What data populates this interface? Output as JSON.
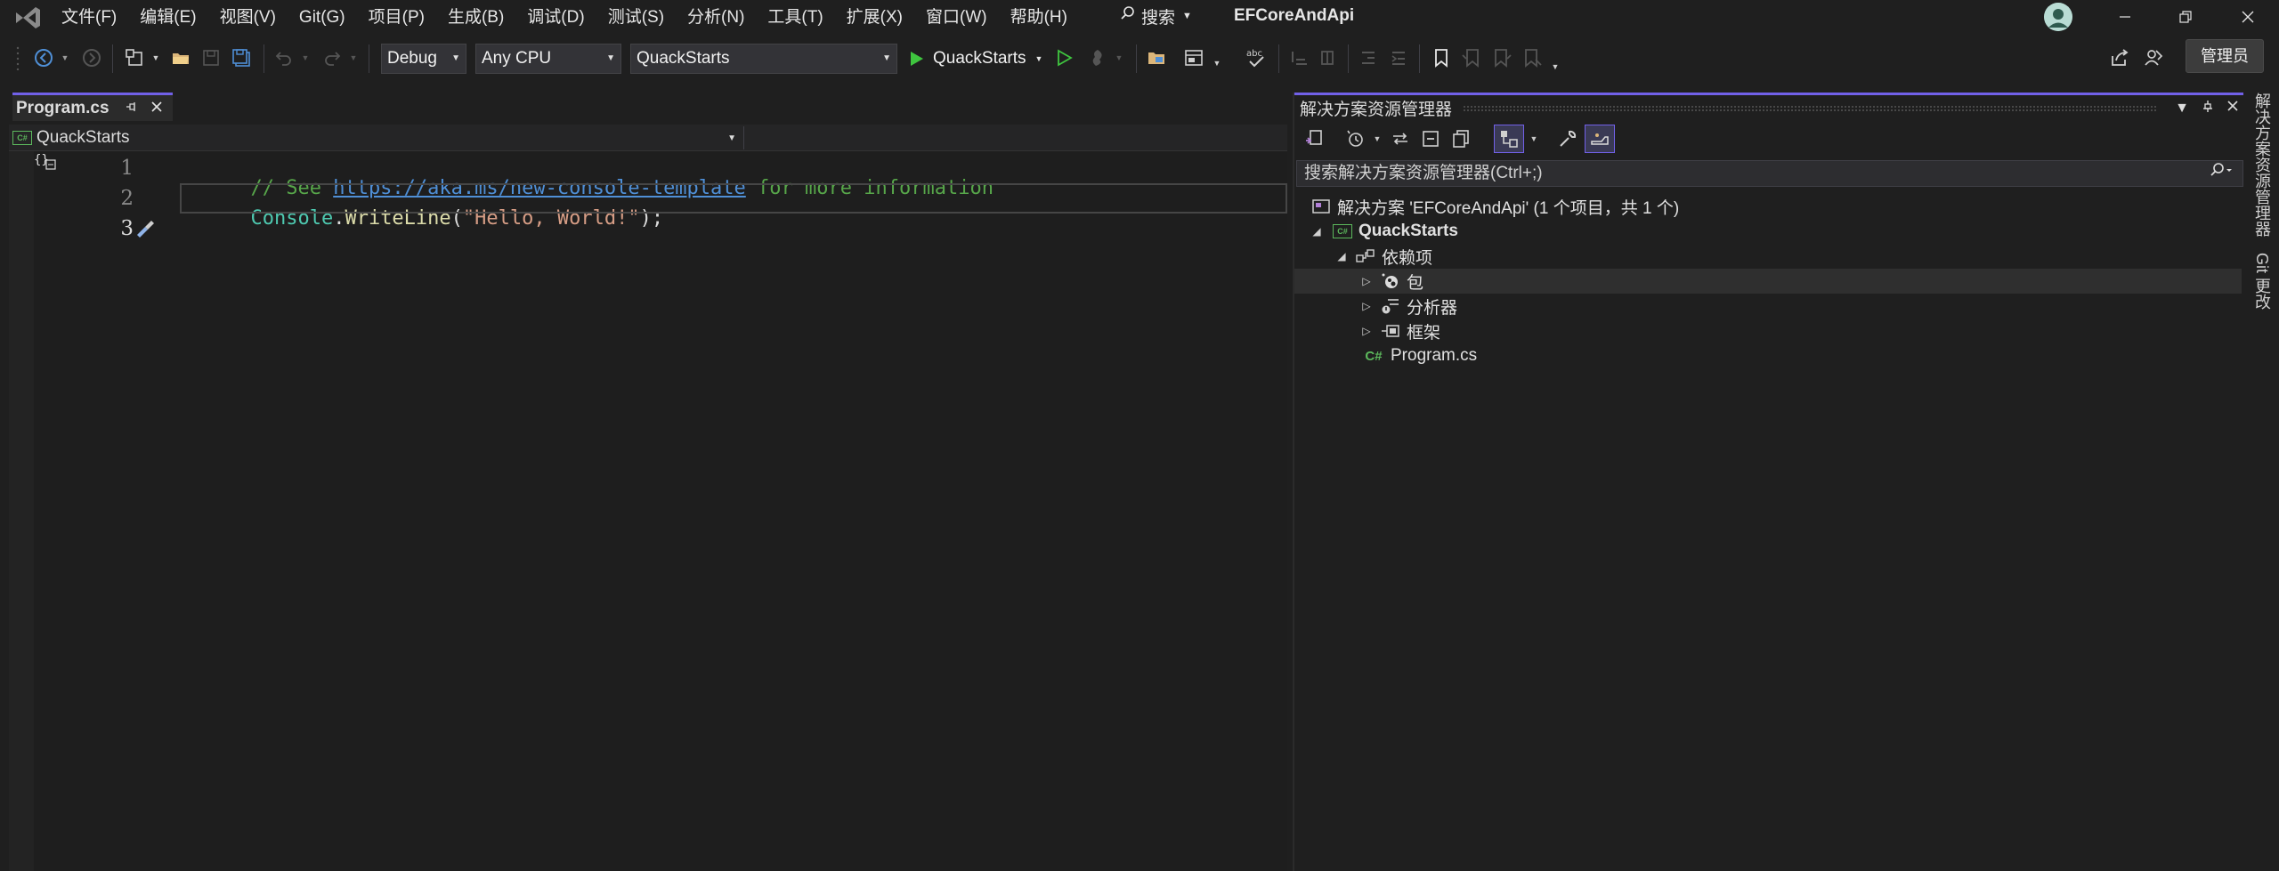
{
  "menu": [
    "文件(F)",
    "编辑(E)",
    "视图(V)",
    "Git(G)",
    "项目(P)",
    "生成(B)",
    "调试(D)",
    "测试(S)",
    "分析(N)",
    "工具(T)",
    "扩展(X)",
    "窗口(W)",
    "帮助(H)"
  ],
  "search": {
    "label": "搜索"
  },
  "solution_name": "EFCoreAndApi",
  "toolbar": {
    "config": "Debug",
    "platform": "Any CPU",
    "startup_project": "QuackStarts",
    "run_label": "QuackStarts",
    "admin_label": "管理员"
  },
  "editor": {
    "tab_name": "Program.cs",
    "nav_project": "QuackStarts",
    "lines": [
      {
        "num": "1",
        "comment_prefix": "// See ",
        "link": "https://aka.ms/new-console-template",
        "comment_suffix": " for more information"
      },
      {
        "num": "2",
        "type": "Console",
        "dot": ".",
        "method": "WriteLine",
        "open": "(",
        "string": "\"Hello, World!\"",
        "close": ");"
      },
      {
        "num": "3"
      }
    ]
  },
  "solution_explorer": {
    "title": "解决方案资源管理器",
    "search_placeholder": "搜索解决方案资源管理器(Ctrl+;)",
    "tree": {
      "solution": "解决方案 'EFCoreAndApi' (1 个项目，共 1 个)",
      "project": "QuackStarts",
      "dependencies": "依赖项",
      "packages": "包",
      "analyzers": "分析器",
      "frameworks": "框架",
      "file": "Program.cs"
    }
  },
  "side_tabs": {
    "solution_explorer": "解决方案资源管理器",
    "git_changes": "Git 更改"
  },
  "colors": {
    "accent": "#7160e8",
    "run_green": "#3fc53f",
    "csharp_green": "#5cb85c"
  }
}
